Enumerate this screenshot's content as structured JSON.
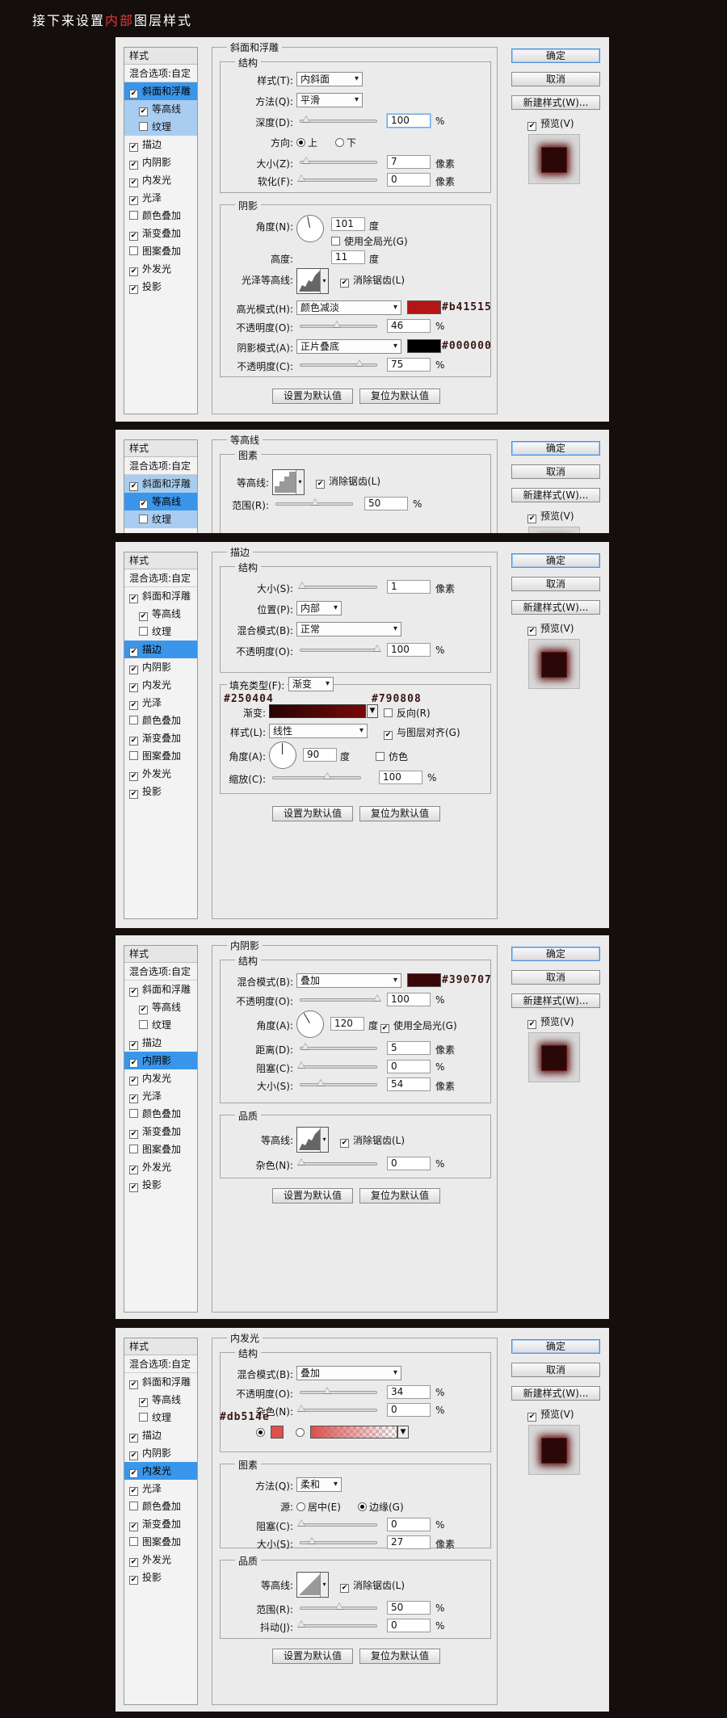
{
  "heading": {
    "pre": "接下来设置",
    "highlight": "内部",
    "post": "图层样式"
  },
  "common": {
    "sidebar_title": "样式",
    "blend_item": "混合选项:自定",
    "ok": "确定",
    "cancel": "取消",
    "new_style": "新建样式(W)...",
    "preview": "预览(V)",
    "set_default": "设置为默认值",
    "reset_default": "复位为默认值",
    "pixels": "像素",
    "percent": "%",
    "degree": "度"
  },
  "sidebar": {
    "bevel": "斜面和浮雕",
    "contour": "等高线",
    "texture": "纹理",
    "stroke": "描边",
    "inner_shadow": "内阴影",
    "inner_glow": "内发光",
    "satin": "光泽",
    "color_overlay": "颜色叠加",
    "gradient_overlay": "渐变叠加",
    "pattern_overlay": "图案叠加",
    "outer_glow": "外发光",
    "drop_shadow": "投影"
  },
  "colors": {
    "highlight": "#b41515",
    "shadow": "#000000",
    "stroke_start": "#250404",
    "stroke_end": "#790808",
    "inner_shadow": "#390707",
    "inner_glow": "#db514e"
  },
  "p1": {
    "title": "斜面和浮雕",
    "structure": "结构",
    "style_label": "样式(T):",
    "style_val": "内斜面",
    "method_label": "方法(Q):",
    "method_val": "平滑",
    "depth_label": "深度(D):",
    "depth_val": "100",
    "direction_label": "方向:",
    "dir_up": "上",
    "dir_down": "下",
    "size_label": "大小(Z):",
    "size_val": "7",
    "soften_label": "软化(F):",
    "soften_val": "0",
    "shading": "阴影",
    "angle_label": "角度(N):",
    "angle_val": "101",
    "global_light": "使用全局光(G)",
    "altitude_label": "高度:",
    "altitude_val": "11",
    "gloss_label": "光泽等高线:",
    "anti_alias": "消除锯齿(L)",
    "hl_mode_label": "高光模式(H):",
    "hl_mode_val": "颜色减淡",
    "hl_op_label": "不透明度(O):",
    "hl_op_val": "46",
    "sh_mode_label": "阴影模式(A):",
    "sh_mode_val": "正片叠底",
    "sh_op_label": "不透明度(C):",
    "sh_op_val": "75",
    "hl_hex": "#b41515",
    "sh_hex": "#000000"
  },
  "p2": {
    "title": "等高线",
    "section": "图素",
    "contour_label": "等高线:",
    "anti_alias": "消除锯齿(L)",
    "range_label": "范围(R):",
    "range_val": "50"
  },
  "p3": {
    "title": "描边",
    "structure": "结构",
    "size_label": "大小(S):",
    "size_val": "1",
    "position_label": "位置(P):",
    "position_val": "内部",
    "blend_label": "混合模式(B):",
    "blend_val": "正常",
    "opacity_label": "不透明度(O):",
    "opacity_val": "100",
    "fill_label": "填充类型(F):",
    "fill_val": "渐变",
    "gradient_label": "渐变:",
    "reverse": "反向(R)",
    "style_label": "样式(L):",
    "style_val": "线性",
    "align": "与图层对齐(G)",
    "angle_label": "角度(A):",
    "angle_val": "90",
    "dither": "仿色",
    "scale_label": "缩放(C):",
    "scale_val": "100",
    "start_hex": "#250404",
    "end_hex": "#790808"
  },
  "p4": {
    "title": "内阴影",
    "structure": "结构",
    "blend_label": "混合模式(B):",
    "blend_val": "叠加",
    "opacity_label": "不透明度(O):",
    "opacity_val": "100",
    "angle_label": "角度(A):",
    "angle_val": "120",
    "global_light": "使用全局光(G)",
    "distance_label": "距离(D):",
    "distance_val": "5",
    "choke_label": "阻塞(C):",
    "choke_val": "0",
    "size_label": "大小(S):",
    "size_val": "54",
    "quality": "品质",
    "contour_label": "等高线:",
    "anti_alias": "消除锯齿(L)",
    "noise_label": "杂色(N):",
    "noise_val": "0",
    "hex": "#390707"
  },
  "p5": {
    "title": "内发光",
    "structure": "结构",
    "blend_label": "混合模式(B):",
    "blend_val": "叠加",
    "opacity_label": "不透明度(O):",
    "opacity_val": "34",
    "noise_label": "杂色(N):",
    "noise_val": "0",
    "hex": "#db514e",
    "elements": "图素",
    "technique_label": "方法(Q):",
    "technique_val": "柔和",
    "source_label": "源:",
    "source_center": "居中(E)",
    "source_edge": "边缘(G)",
    "choke_label": "阻塞(C):",
    "choke_val": "0",
    "size_label": "大小(S):",
    "size_val": "27",
    "quality": "品质",
    "contour_label": "等高线:",
    "anti_alias": "消除锯齿(L)",
    "range_label": "范围(R):",
    "range_val": "50",
    "jitter_label": "抖动(J):",
    "jitter_val": "0"
  }
}
